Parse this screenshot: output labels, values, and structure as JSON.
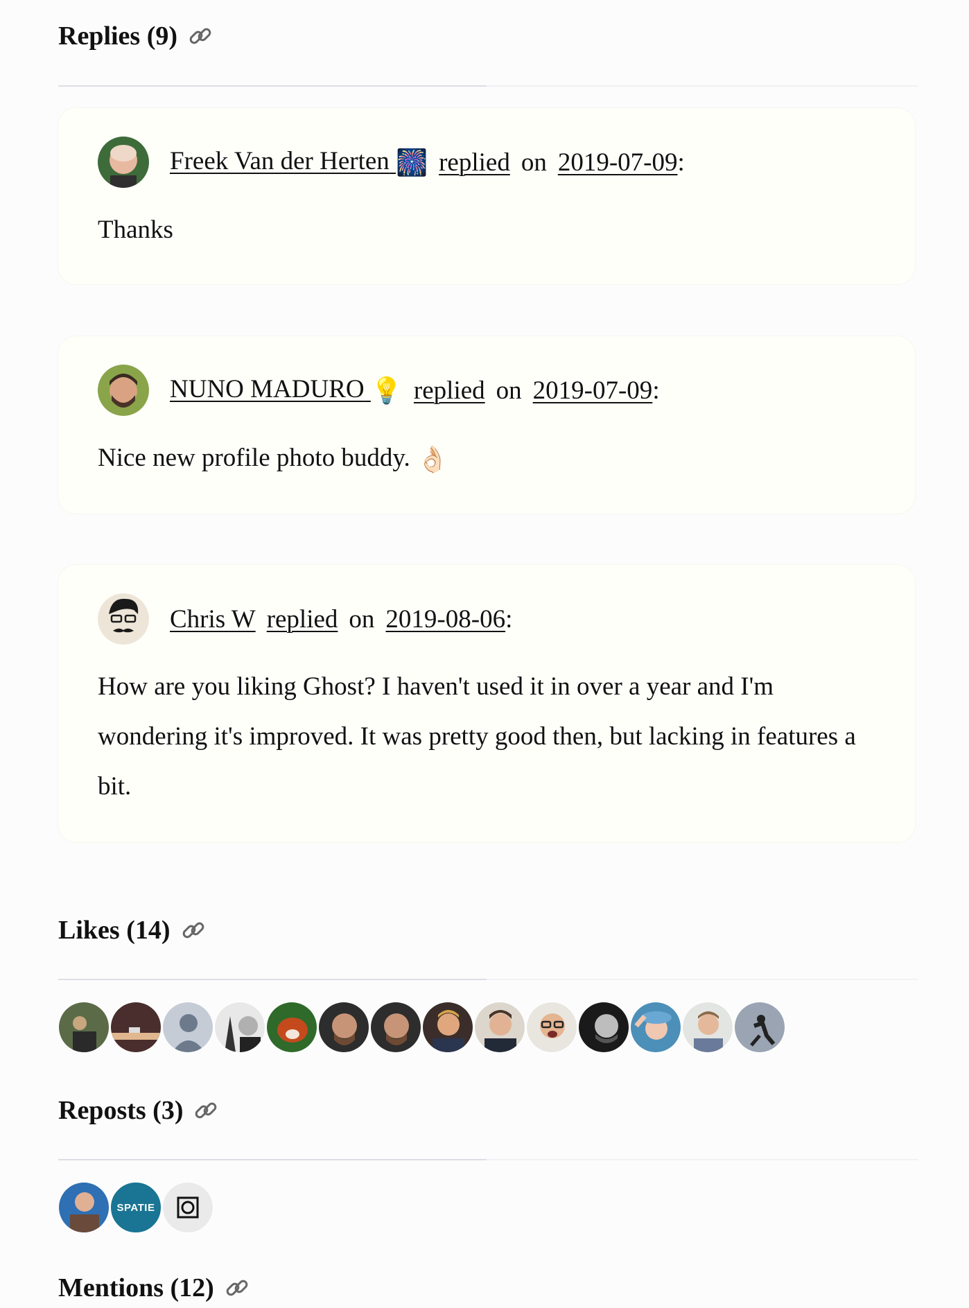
{
  "replies": {
    "heading": "Replies (9)",
    "items": [
      {
        "author": "Freek Van der Herten",
        "author_emoji": "🎆",
        "verb": "replied",
        "on": "on",
        "date": "2019-07-09",
        "colon": ":",
        "body": "Thanks"
      },
      {
        "author": "NUNO MADURO",
        "author_emoji": "💡",
        "verb": "replied",
        "on": "on",
        "date": "2019-07-09",
        "colon": ":",
        "body": "Nice new profile photo buddy.",
        "body_emoji": "👌🏻"
      },
      {
        "author": "Chris W",
        "author_emoji": "",
        "verb": "replied",
        "on": "on",
        "date": "2019-08-06",
        "colon": ":",
        "body": "How are you liking Ghost? I haven't used it in over a year and I'm wondering it's improved. It was pretty good then, but lacking in features a bit."
      }
    ]
  },
  "likes": {
    "heading": "Likes (14)"
  },
  "reposts": {
    "heading": "Reposts (3)",
    "spatie_label": "SPATIE"
  },
  "mentions": {
    "heading": "Mentions (12)"
  },
  "icons": {
    "heading_link": "link-icon"
  },
  "colors": {
    "card_bg": "#fffffa",
    "page_bg": "#fcfcfd",
    "spatie_bg": "#197593"
  }
}
